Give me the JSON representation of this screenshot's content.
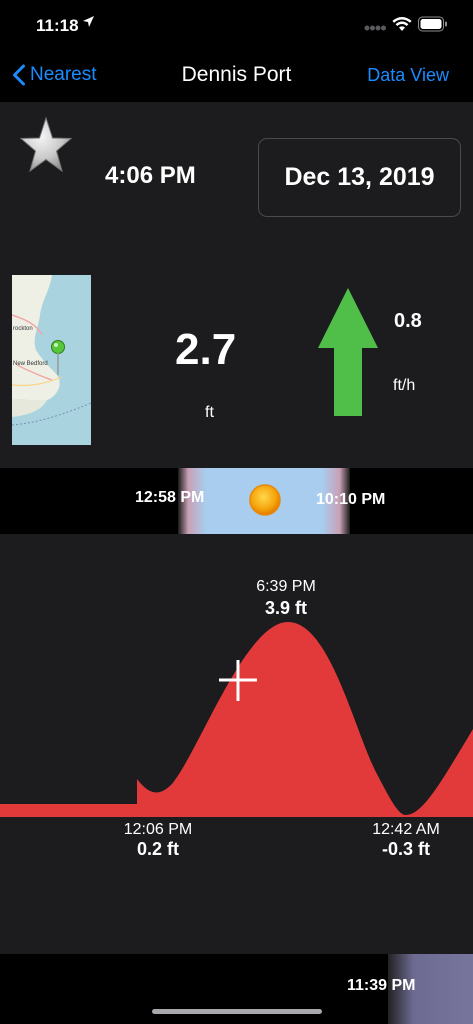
{
  "status_bar": {
    "time": "11:18"
  },
  "nav": {
    "back_label": "Nearest",
    "title": "Dennis Port",
    "right_label": "Data View"
  },
  "summary": {
    "current_time": "4:06 PM",
    "date": "Dec 13, 2019",
    "tide_height": "2.7",
    "tide_height_unit": "ft",
    "rate": "0.8",
    "rate_unit": "ft/h",
    "favorite": false
  },
  "daylight": {
    "sunrise": "12:58 PM",
    "sunset": "10:10 PM"
  },
  "tide_chart": {
    "high": {
      "time": "6:39 PM",
      "height": "3.9 ft"
    },
    "low_1": {
      "time": "12:06 PM",
      "height": "0.2 ft"
    },
    "low_2": {
      "time": "12:42 AM",
      "height": "-0.3 ft"
    }
  },
  "moon": {
    "moonrise": "11:39 PM"
  },
  "colors": {
    "accent": "#1a8cff",
    "arrow": "#4fbf4a",
    "water_high": "#1e2fb8",
    "water_low": "#e23a3a"
  }
}
